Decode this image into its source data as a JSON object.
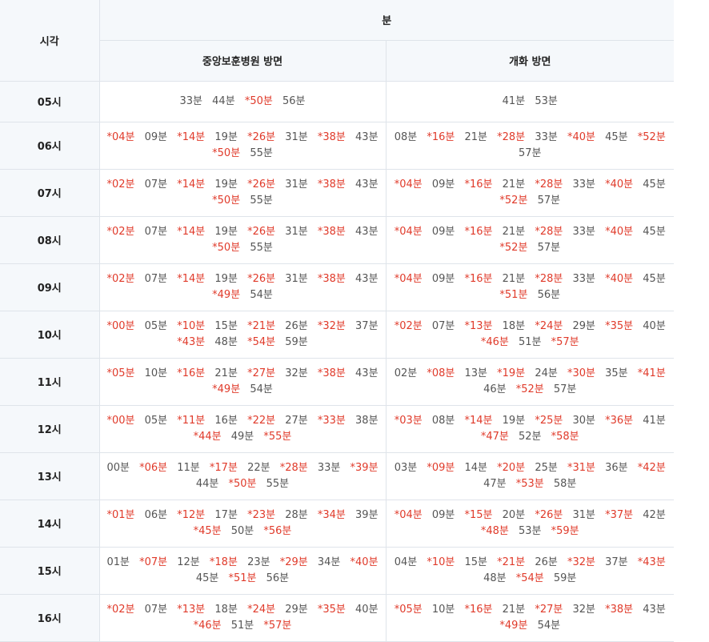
{
  "header": {
    "time_col": "시각",
    "minutes_col": "분",
    "dir_a": "중앙보훈병원 방면",
    "dir_b": "개화 방면"
  },
  "rows": [
    {
      "hour": "05시",
      "a": [
        {
          "t": "33분"
        },
        {
          "t": "44분"
        },
        {
          "t": "*50분",
          "hl": true
        },
        {
          "t": "56분"
        }
      ],
      "b": [
        {
          "t": "41분"
        },
        {
          "t": "53분"
        }
      ]
    },
    {
      "hour": "06시",
      "a": [
        {
          "t": "*04분",
          "hl": true
        },
        {
          "t": "09분"
        },
        {
          "t": "*14분",
          "hl": true
        },
        {
          "t": "19분"
        },
        {
          "t": "*26분",
          "hl": true
        },
        {
          "t": "31분"
        },
        {
          "t": "*38분",
          "hl": true
        },
        {
          "t": "43분"
        },
        {
          "t": "*50분",
          "hl": true
        },
        {
          "t": "55분"
        }
      ],
      "b": [
        {
          "t": "08분"
        },
        {
          "t": "*16분",
          "hl": true
        },
        {
          "t": "21분"
        },
        {
          "t": "*28분",
          "hl": true
        },
        {
          "t": "33분"
        },
        {
          "t": "*40분",
          "hl": true
        },
        {
          "t": "45분"
        },
        {
          "t": "*52분",
          "hl": true
        },
        {
          "t": "57분"
        }
      ]
    },
    {
      "hour": "07시",
      "a": [
        {
          "t": "*02분",
          "hl": true
        },
        {
          "t": "07분"
        },
        {
          "t": "*14분",
          "hl": true
        },
        {
          "t": "19분"
        },
        {
          "t": "*26분",
          "hl": true
        },
        {
          "t": "31분"
        },
        {
          "t": "*38분",
          "hl": true
        },
        {
          "t": "43분"
        },
        {
          "t": "*50분",
          "hl": true
        },
        {
          "t": "55분"
        }
      ],
      "b": [
        {
          "t": "*04분",
          "hl": true
        },
        {
          "t": "09분"
        },
        {
          "t": "*16분",
          "hl": true
        },
        {
          "t": "21분"
        },
        {
          "t": "*28분",
          "hl": true
        },
        {
          "t": "33분"
        },
        {
          "t": "*40분",
          "hl": true
        },
        {
          "t": "45분"
        },
        {
          "t": "*52분",
          "hl": true
        },
        {
          "t": "57분"
        }
      ]
    },
    {
      "hour": "08시",
      "a": [
        {
          "t": "*02분",
          "hl": true
        },
        {
          "t": "07분"
        },
        {
          "t": "*14분",
          "hl": true
        },
        {
          "t": "19분"
        },
        {
          "t": "*26분",
          "hl": true
        },
        {
          "t": "31분"
        },
        {
          "t": "*38분",
          "hl": true
        },
        {
          "t": "43분"
        },
        {
          "t": "*50분",
          "hl": true
        },
        {
          "t": "55분"
        }
      ],
      "b": [
        {
          "t": "*04분",
          "hl": true
        },
        {
          "t": "09분"
        },
        {
          "t": "*16분",
          "hl": true
        },
        {
          "t": "21분"
        },
        {
          "t": "*28분",
          "hl": true
        },
        {
          "t": "33분"
        },
        {
          "t": "*40분",
          "hl": true
        },
        {
          "t": "45분"
        },
        {
          "t": "*52분",
          "hl": true
        },
        {
          "t": "57분"
        }
      ]
    },
    {
      "hour": "09시",
      "a": [
        {
          "t": "*02분",
          "hl": true
        },
        {
          "t": "07분"
        },
        {
          "t": "*14분",
          "hl": true
        },
        {
          "t": "19분"
        },
        {
          "t": "*26분",
          "hl": true
        },
        {
          "t": "31분"
        },
        {
          "t": "*38분",
          "hl": true
        },
        {
          "t": "43분"
        },
        {
          "t": "*49분",
          "hl": true
        },
        {
          "t": "54분"
        }
      ],
      "b": [
        {
          "t": "*04분",
          "hl": true
        },
        {
          "t": "09분"
        },
        {
          "t": "*16분",
          "hl": true
        },
        {
          "t": "21분"
        },
        {
          "t": "*28분",
          "hl": true
        },
        {
          "t": "33분"
        },
        {
          "t": "*40분",
          "hl": true
        },
        {
          "t": "45분"
        },
        {
          "t": "*51분",
          "hl": true
        },
        {
          "t": "56분"
        }
      ]
    },
    {
      "hour": "10시",
      "a": [
        {
          "t": "*00분",
          "hl": true
        },
        {
          "t": "05분"
        },
        {
          "t": "*10분",
          "hl": true
        },
        {
          "t": "15분"
        },
        {
          "t": "*21분",
          "hl": true
        },
        {
          "t": "26분"
        },
        {
          "t": "*32분",
          "hl": true
        },
        {
          "t": "37분"
        },
        {
          "t": "*43분",
          "hl": true
        },
        {
          "t": "48분"
        },
        {
          "t": "*54분",
          "hl": true
        },
        {
          "t": "59분"
        }
      ],
      "b": [
        {
          "t": "*02분",
          "hl": true
        },
        {
          "t": "07분"
        },
        {
          "t": "*13분",
          "hl": true
        },
        {
          "t": "18분"
        },
        {
          "t": "*24분",
          "hl": true
        },
        {
          "t": "29분"
        },
        {
          "t": "*35분",
          "hl": true
        },
        {
          "t": "40분"
        },
        {
          "t": "*46분",
          "hl": true
        },
        {
          "t": "51분"
        },
        {
          "t": "*57분",
          "hl": true
        }
      ]
    },
    {
      "hour": "11시",
      "a": [
        {
          "t": "*05분",
          "hl": true
        },
        {
          "t": "10분"
        },
        {
          "t": "*16분",
          "hl": true
        },
        {
          "t": "21분"
        },
        {
          "t": "*27분",
          "hl": true
        },
        {
          "t": "32분"
        },
        {
          "t": "*38분",
          "hl": true
        },
        {
          "t": "43분"
        },
        {
          "t": "*49분",
          "hl": true
        },
        {
          "t": "54분"
        }
      ],
      "b": [
        {
          "t": "02분"
        },
        {
          "t": "*08분",
          "hl": true
        },
        {
          "t": "13분"
        },
        {
          "t": "*19분",
          "hl": true
        },
        {
          "t": "24분"
        },
        {
          "t": "*30분",
          "hl": true
        },
        {
          "t": "35분"
        },
        {
          "t": "*41분",
          "hl": true
        },
        {
          "t": "46분"
        },
        {
          "t": "*52분",
          "hl": true
        },
        {
          "t": "57분"
        }
      ]
    },
    {
      "hour": "12시",
      "a": [
        {
          "t": "*00분",
          "hl": true
        },
        {
          "t": "05분"
        },
        {
          "t": "*11분",
          "hl": true
        },
        {
          "t": "16분"
        },
        {
          "t": "*22분",
          "hl": true
        },
        {
          "t": "27분"
        },
        {
          "t": "*33분",
          "hl": true
        },
        {
          "t": "38분"
        },
        {
          "t": "*44분",
          "hl": true
        },
        {
          "t": "49분"
        },
        {
          "t": "*55분",
          "hl": true
        }
      ],
      "b": [
        {
          "t": "*03분",
          "hl": true
        },
        {
          "t": "08분"
        },
        {
          "t": "*14분",
          "hl": true
        },
        {
          "t": "19분"
        },
        {
          "t": "*25분",
          "hl": true
        },
        {
          "t": "30분"
        },
        {
          "t": "*36분",
          "hl": true
        },
        {
          "t": "41분"
        },
        {
          "t": "*47분",
          "hl": true
        },
        {
          "t": "52분"
        },
        {
          "t": "*58분",
          "hl": true
        }
      ]
    },
    {
      "hour": "13시",
      "a": [
        {
          "t": "00분"
        },
        {
          "t": "*06분",
          "hl": true
        },
        {
          "t": "11분"
        },
        {
          "t": "*17분",
          "hl": true
        },
        {
          "t": "22분"
        },
        {
          "t": "*28분",
          "hl": true
        },
        {
          "t": "33분"
        },
        {
          "t": "*39분",
          "hl": true
        },
        {
          "t": "44분"
        },
        {
          "t": "*50분",
          "hl": true
        },
        {
          "t": "55분"
        }
      ],
      "b": [
        {
          "t": "03분"
        },
        {
          "t": "*09분",
          "hl": true
        },
        {
          "t": "14분"
        },
        {
          "t": "*20분",
          "hl": true
        },
        {
          "t": "25분"
        },
        {
          "t": "*31분",
          "hl": true
        },
        {
          "t": "36분"
        },
        {
          "t": "*42분",
          "hl": true
        },
        {
          "t": "47분"
        },
        {
          "t": "*53분",
          "hl": true
        },
        {
          "t": "58분"
        }
      ]
    },
    {
      "hour": "14시",
      "a": [
        {
          "t": "*01분",
          "hl": true
        },
        {
          "t": "06분"
        },
        {
          "t": "*12분",
          "hl": true
        },
        {
          "t": "17분"
        },
        {
          "t": "*23분",
          "hl": true
        },
        {
          "t": "28분"
        },
        {
          "t": "*34분",
          "hl": true
        },
        {
          "t": "39분"
        },
        {
          "t": "*45분",
          "hl": true
        },
        {
          "t": "50분"
        },
        {
          "t": "*56분",
          "hl": true
        }
      ],
      "b": [
        {
          "t": "*04분",
          "hl": true
        },
        {
          "t": "09분"
        },
        {
          "t": "*15분",
          "hl": true
        },
        {
          "t": "20분"
        },
        {
          "t": "*26분",
          "hl": true
        },
        {
          "t": "31분"
        },
        {
          "t": "*37분",
          "hl": true
        },
        {
          "t": "42분"
        },
        {
          "t": "*48분",
          "hl": true
        },
        {
          "t": "53분"
        },
        {
          "t": "*59분",
          "hl": true
        }
      ]
    },
    {
      "hour": "15시",
      "a": [
        {
          "t": "01분"
        },
        {
          "t": "*07분",
          "hl": true
        },
        {
          "t": "12분"
        },
        {
          "t": "*18분",
          "hl": true
        },
        {
          "t": "23분"
        },
        {
          "t": "*29분",
          "hl": true
        },
        {
          "t": "34분"
        },
        {
          "t": "*40분",
          "hl": true
        },
        {
          "t": "45분"
        },
        {
          "t": "*51분",
          "hl": true
        },
        {
          "t": "56분"
        }
      ],
      "b": [
        {
          "t": "04분"
        },
        {
          "t": "*10분",
          "hl": true
        },
        {
          "t": "15분"
        },
        {
          "t": "*21분",
          "hl": true
        },
        {
          "t": "26분"
        },
        {
          "t": "*32분",
          "hl": true
        },
        {
          "t": "37분"
        },
        {
          "t": "*43분",
          "hl": true
        },
        {
          "t": "48분"
        },
        {
          "t": "*54분",
          "hl": true
        },
        {
          "t": "59분"
        }
      ]
    },
    {
      "hour": "16시",
      "a": [
        {
          "t": "*02분",
          "hl": true
        },
        {
          "t": "07분"
        },
        {
          "t": "*13분",
          "hl": true
        },
        {
          "t": "18분"
        },
        {
          "t": "*24분",
          "hl": true
        },
        {
          "t": "29분"
        },
        {
          "t": "*35분",
          "hl": true
        },
        {
          "t": "40분"
        },
        {
          "t": "*46분",
          "hl": true
        },
        {
          "t": "51분"
        },
        {
          "t": "*57분",
          "hl": true
        }
      ],
      "b": [
        {
          "t": "*05분",
          "hl": true
        },
        {
          "t": "10분"
        },
        {
          "t": "*16분",
          "hl": true
        },
        {
          "t": "21분"
        },
        {
          "t": "*27분",
          "hl": true
        },
        {
          "t": "32분"
        },
        {
          "t": "*38분",
          "hl": true
        },
        {
          "t": "43분"
        },
        {
          "t": "*49분",
          "hl": true
        },
        {
          "t": "54분"
        }
      ]
    }
  ]
}
